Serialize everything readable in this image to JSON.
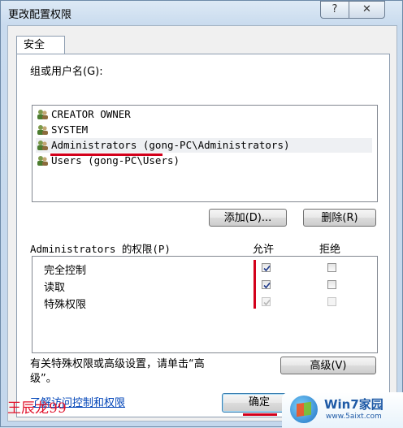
{
  "window": {
    "title": "更改配置权限",
    "help_glyph": "?",
    "close_glyph": "✕"
  },
  "tab": {
    "label": "安全"
  },
  "groups_label": "组或用户名(G):",
  "users": [
    {
      "name": "CREATOR OWNER",
      "selected": false
    },
    {
      "name": "SYSTEM",
      "selected": false
    },
    {
      "name": "Administrators (gong-PC\\Administrators)",
      "selected": true
    },
    {
      "name": "Users (gong-PC\\Users)",
      "selected": false
    }
  ],
  "buttons": {
    "add": "添加(D)...",
    "remove": "删除(R)",
    "advanced": "高级(V)",
    "ok": "确定"
  },
  "permissions": {
    "title": "Administrators 的权限(P)",
    "allow_header": "允许",
    "deny_header": "拒绝",
    "rows": [
      {
        "name": "完全控制",
        "allow": true,
        "deny": false,
        "enabled": true
      },
      {
        "name": "读取",
        "allow": true,
        "deny": false,
        "enabled": true
      },
      {
        "name": "特殊权限",
        "allow": true,
        "deny": false,
        "enabled": false
      }
    ]
  },
  "special_note": {
    "line1": "有关特殊权限或高级设置，请单击“高",
    "line2": "级”。"
  },
  "help_link": "了解访问控制和权限",
  "overlay": {
    "watermark": "王辰龙99",
    "logo_title": "Win7家园",
    "logo_url": "www.5aixt.com"
  },
  "colors": {
    "annotation_red": "#d3001b",
    "link": "#0044b8"
  }
}
